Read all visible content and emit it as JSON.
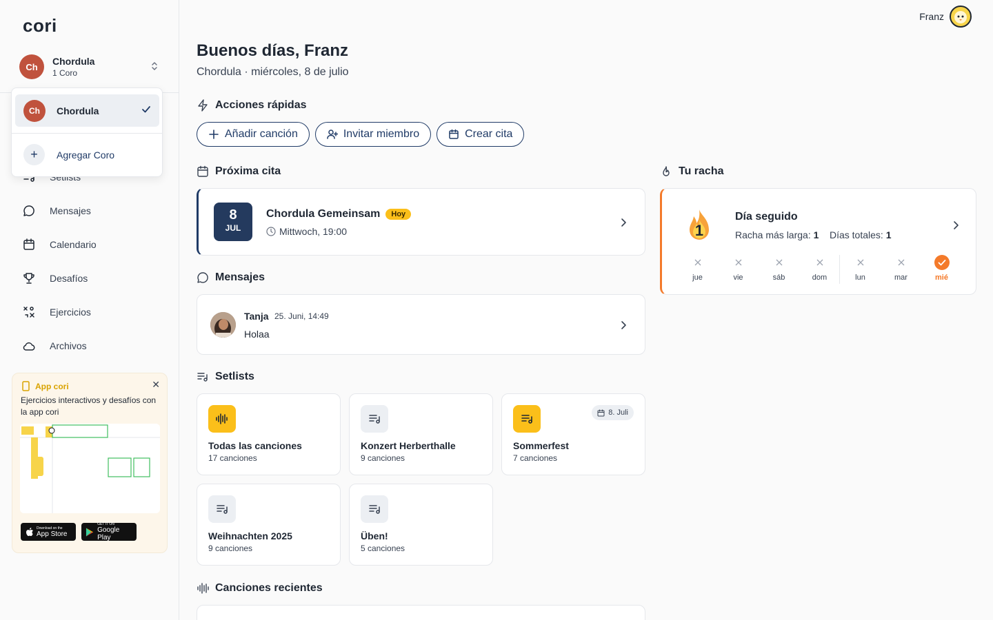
{
  "app": {
    "logo": "cori"
  },
  "sidebar": {
    "choir": {
      "initials": "Ch",
      "name": "Chordula",
      "sub": "1 Coro"
    },
    "nav": [
      {
        "label": "Setlists",
        "icon": "setlist-icon"
      },
      {
        "label": "Mensajes",
        "icon": "message-icon"
      },
      {
        "label": "Calendario",
        "icon": "calendar-icon"
      },
      {
        "label": "Desafíos",
        "icon": "trophy-icon"
      },
      {
        "label": "Ejercicios",
        "icon": "exercise-icon"
      },
      {
        "label": "Archivos",
        "icon": "cloud-icon"
      }
    ],
    "promo": {
      "title": "App cori",
      "text": "Ejercicios interactivos y desafíos con la app cori",
      "appstore_small": "Download on the",
      "appstore_big": "App Store",
      "googleplay_small": "GET IT ON",
      "googleplay_big": "Google Play"
    }
  },
  "dropdown": {
    "selected": {
      "initials": "Ch",
      "name": "Chordula"
    },
    "add_label": "Agregar Coro"
  },
  "user": {
    "name": "Franz"
  },
  "header": {
    "greeting": "Buenos días, Franz",
    "subline": "Chordula · miércoles, 8 de julio"
  },
  "quick_actions": {
    "title": "Acciones rápidas",
    "buttons": [
      {
        "label": "Añadir canción"
      },
      {
        "label": "Invitar miembro"
      },
      {
        "label": "Crear cita"
      }
    ]
  },
  "next_appointment": {
    "title": "Próxima cita",
    "day": "8",
    "month": "JUL",
    "name": "Chordula Gemeinsam",
    "badge": "Hoy",
    "time": "Mittwoch, 19:00"
  },
  "messages": {
    "title": "Mensajes",
    "latest": {
      "name": "Tanja",
      "time": "25. Juni, 14:49",
      "text": "Holaa"
    }
  },
  "setlists": {
    "title": "Setlists",
    "items": [
      {
        "title": "Todas las canciones",
        "sub": "17 canciones",
        "date": ""
      },
      {
        "title": "Konzert Herberthalle",
        "sub": "9 canciones",
        "date": ""
      },
      {
        "title": "Sommerfest",
        "sub": "7 canciones",
        "date": "8. Juli"
      },
      {
        "title": "Weihnachten 2025",
        "sub": "9 canciones",
        "date": ""
      },
      {
        "title": "Üben!",
        "sub": "5 canciones",
        "date": ""
      }
    ]
  },
  "recent_songs": {
    "title": "Canciones recientes"
  },
  "streak": {
    "title": "Tu racha",
    "count": "1",
    "card_title": "Día seguido",
    "longest_label": "Racha más larga:",
    "longest_value": "1",
    "total_label": "Días totales:",
    "total_value": "1",
    "days": [
      "jue",
      "vie",
      "sáb",
      "dom",
      "lun",
      "mar",
      "mié"
    ]
  },
  "colors": {
    "accent": "#1f3a66",
    "yellow": "#fbbf1a",
    "streak": "#f47a2a",
    "choir": "#c0523d"
  }
}
